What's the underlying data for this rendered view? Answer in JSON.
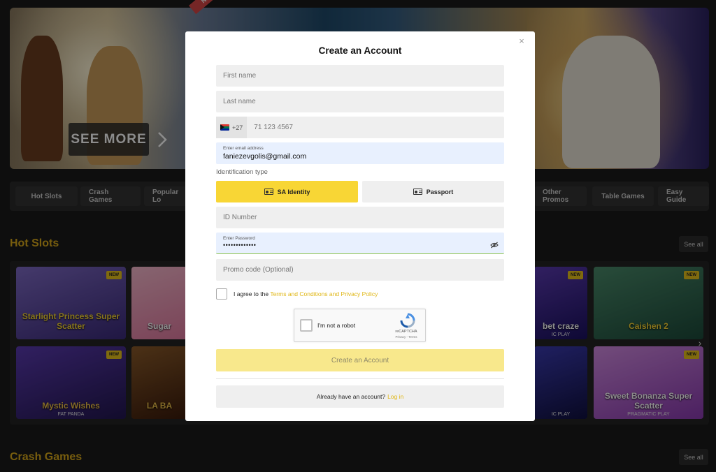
{
  "banner": {
    "ribbon": "NEW",
    "see_more": "SEE MORE"
  },
  "tabs": [
    {
      "label": "Hot Slots"
    },
    {
      "label": "Crash Games"
    },
    {
      "label": "Popular Lo"
    },
    {
      "label": "Other Promos"
    },
    {
      "label": "Table Games"
    },
    {
      "label": "Easy Guide"
    }
  ],
  "sections": {
    "hot_slots": {
      "title": "Hot Slots",
      "see_all": "See all"
    },
    "crash_games": {
      "title": "Crash Games",
      "see_all": "See all"
    }
  },
  "tiles": [
    {
      "title": "Starlight Princess Super Scatter",
      "badge": "NEW",
      "provider": "",
      "color": "#5a4aa0"
    },
    {
      "title": "Sugar",
      "badge": "",
      "provider": "",
      "color": "#ec8fb0"
    },
    {
      "title": "bet craze",
      "badge": "NEW",
      "provider": "IC PLAY",
      "color": "#3a2a80"
    },
    {
      "title": "Caishen 2",
      "badge": "NEW",
      "provider": "",
      "color": "#2d6b58"
    },
    {
      "title": "Mystic Wishes",
      "badge": "NEW",
      "provider": "FAT PANDA",
      "color": "#3a2a7a"
    },
    {
      "title": "LA BA",
      "badge": "",
      "provider": "",
      "color": "#6a3a1a"
    },
    {
      "title": "",
      "badge": "",
      "provider": "IC PLAY",
      "color": "#2d2d80"
    },
    {
      "title": "Sweet Bonanza Super Scatter",
      "badge": "NEW",
      "provider": "PRAGMATIC PLAY",
      "color": "#b86ad0"
    }
  ],
  "modal": {
    "title": "Create an Account",
    "close": "×",
    "first_name_placeholder": "First name",
    "last_name_placeholder": "Last name",
    "phone_code": "+27",
    "phone_placeholder": "71 123 4567",
    "email_label": "Enter email address",
    "email_value": "faniezevgolis@gmail.com",
    "id_type_label": "Identification type",
    "id_sa": "SA Identity",
    "id_passport": "Passport",
    "id_number_placeholder": "ID Number",
    "password_label": "Enter Password",
    "password_value": "•••••••••••••",
    "promo_placeholder": "Promo code (Optional)",
    "agree_text": "I agree to the",
    "agree_link": "Terms and Conditions and Privacy Policy",
    "recaptcha_label": "I'm not a robot",
    "recaptcha_brand": "reCAPTCHA",
    "recaptcha_terms": "Privacy - Terms",
    "submit": "Create an Account",
    "have_account": "Already have an account?",
    "login": "Log in"
  },
  "colors": {
    "accent": "#f8d635",
    "section_title": "#d9a91a",
    "link": "#e0b716"
  }
}
